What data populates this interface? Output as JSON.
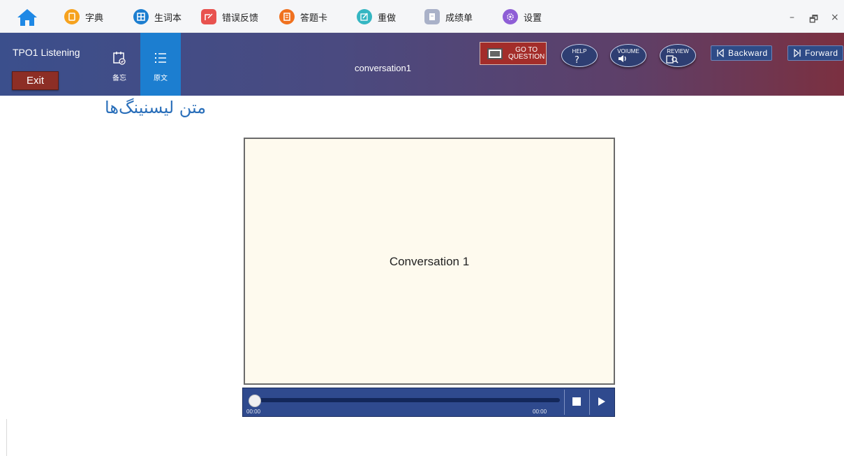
{
  "toolbar": {
    "items": [
      {
        "label": "字典",
        "icon": "dictionary-icon",
        "color": "#f6a21e"
      },
      {
        "label": "生词本",
        "icon": "vocabulary-icon",
        "color": "#1c7ed0"
      },
      {
        "label": "错误反馈",
        "icon": "feedback-icon",
        "color": "#e8524f"
      },
      {
        "label": "答题卡",
        "icon": "answer-card-icon",
        "color": "#f0711f"
      },
      {
        "label": "重做",
        "icon": "redo-icon",
        "color": "#35b6c2"
      },
      {
        "label": "成绩单",
        "icon": "report-icon",
        "color": "#a9b1c8"
      },
      {
        "label": "设置",
        "icon": "settings-icon",
        "color": "#8e5ed6"
      }
    ],
    "window_controls": {
      "minimize": "–",
      "restore": "🗗",
      "close": "×"
    }
  },
  "header": {
    "title": "TPO1 Listening",
    "exit_label": "Exit",
    "tabs": [
      {
        "label": "备忘",
        "icon": "memo-icon",
        "active": false
      },
      {
        "label": "原文",
        "icon": "transcript-icon",
        "active": true
      }
    ],
    "center_title": "conversation1",
    "goto_line1": "GO TO",
    "goto_line2": "QUESTION",
    "help_label": "HELP",
    "volume_label": "VOIUME",
    "review_label": "REVIEW",
    "backward_label": "Backward",
    "forward_label": "Forward"
  },
  "caption": "متن لیسنینگ‌ها",
  "player": {
    "screen_title": "Conversation 1",
    "time_current": "00:00",
    "time_total": "00:00",
    "progress": 0
  },
  "colors": {
    "accent": "#1c7ed0",
    "exit_red": "#8d2e25",
    "player_blue": "#2f4a8e"
  }
}
